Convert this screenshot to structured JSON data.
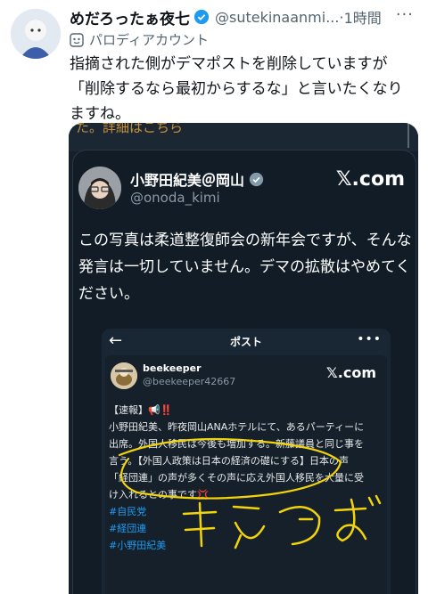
{
  "post": {
    "display_name": "めだろったぁ夜七",
    "handle": "@sutekinaanmi...",
    "dot": "·",
    "time": "1時間",
    "more": "···",
    "parody_label": "パロディアカウント",
    "text_lines": [
      "指摘された側がデマポストを削除していますが",
      "「削除するなら最初からするな」と言いたくなり",
      "ますね。"
    ]
  },
  "embed": {
    "partial_text": "た。詳細はこちら",
    "quoted": {
      "name": "小野田紀美＠岡山",
      "handle": "@onoda_kimi",
      "source": "𝕏.com",
      "text_lines": [
        "この写真は柔道整復師会の新年会ですが、そんな",
        "発言は一切していません。デマの拡散はやめてく",
        "ださい。"
      ]
    },
    "screenshot": {
      "back": "←",
      "title": "ポスト",
      "more": "•••",
      "name": "beekeeper",
      "handle": "@beekeeper42667",
      "source": "𝕏.com",
      "lines": [
        "【速報】📢‼️",
        "小野田紀美、昨夜岡山ANAホテルにて、あるパーティーに",
        "出席。外国人移民は今後も増加する。新藤議員と同じ事を",
        "言う。【外国人政策は日本の経済の礎にする】日本の声",
        "「経団連」の声が多くその声に応え外国人移民を大量に受",
        "け入れるとの事です💢"
      ],
      "hashtags": [
        "#自民党",
        "#経団連",
        "#小野田紀美"
      ]
    }
  },
  "colors": {
    "verified": "#1d9bf0",
    "embed_bg": "#15202b",
    "hashtag": "#1d9bf0",
    "scribble": "#f2d40a",
    "verified_gray": "#829aab"
  }
}
